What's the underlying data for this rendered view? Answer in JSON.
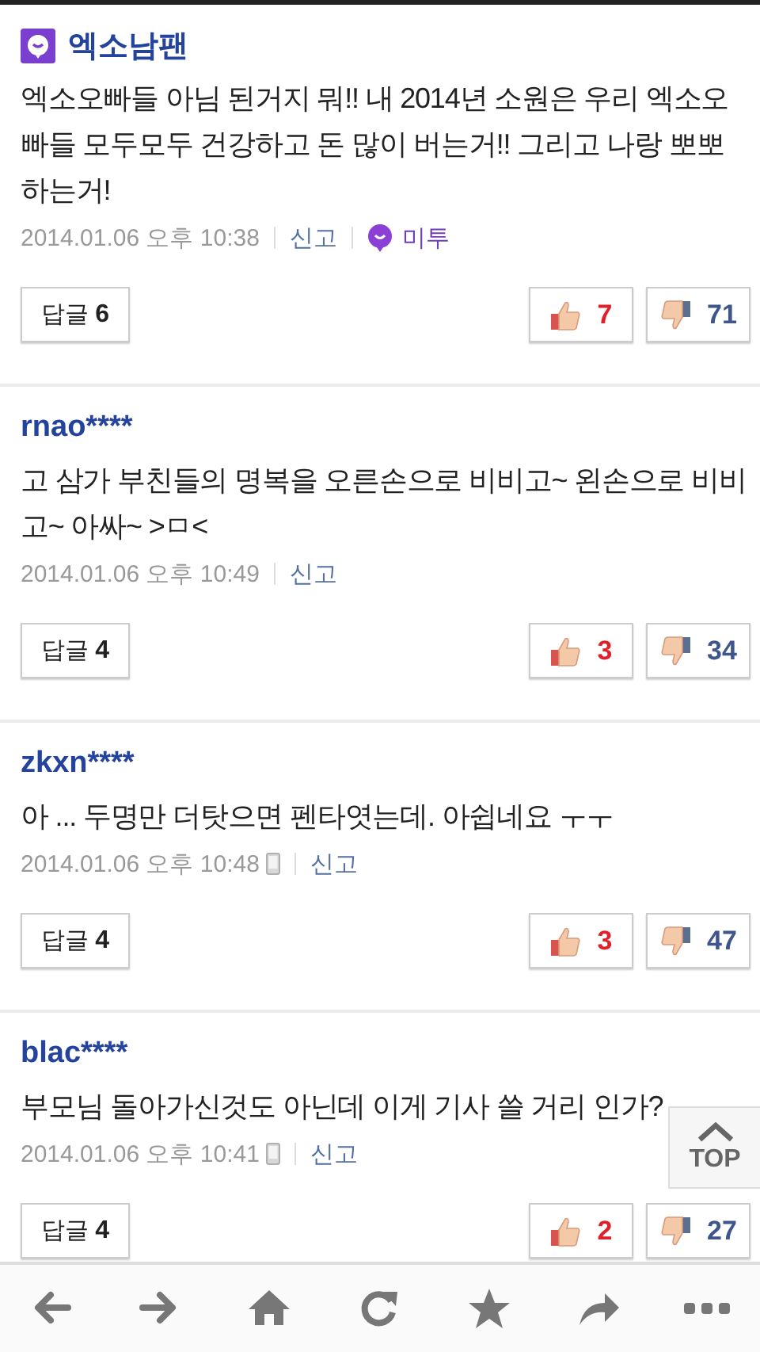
{
  "comments": [
    {
      "author": "엑소남팬",
      "author_badge": true,
      "text": "엑소오빠들 아님 된거지 뭐!! 내 2014년 소원은 우리 엑소오빠들 모두모두 건강하고 돈 많이 버는거!! 그리고 나랑 뽀뽀하는거!",
      "time": "2014.01.06 오후 10:38",
      "mobile": false,
      "report": "신고",
      "metoo": "미투",
      "reply_label": "답글",
      "reply_count": "6",
      "likes": "7",
      "dislikes": "71"
    },
    {
      "author": "rnao****",
      "author_badge": false,
      "text": "고 삼가 부친들의 명복을 오른손으로 비비고~ 왼손으로 비비고~ 아싸~ >ㅁ<",
      "time": "2014.01.06 오후 10:49",
      "mobile": false,
      "report": "신고",
      "reply_label": "답글",
      "reply_count": "4",
      "likes": "3",
      "dislikes": "34"
    },
    {
      "author": "zkxn****",
      "author_badge": false,
      "text": "아 ... 두명만 더탓으면 펜타엿는데. 아쉽네요 ㅜㅜ",
      "time": "2014.01.06 오후 10:48",
      "mobile": true,
      "report": "신고",
      "reply_label": "답글",
      "reply_count": "4",
      "likes": "3",
      "dislikes": "47"
    },
    {
      "author": "blac****",
      "author_badge": false,
      "text": "부모님 돌아가신것도 아닌데 이게 기사 쓸 거리 인가?",
      "time": "2014.01.06 오후 10:41",
      "mobile": true,
      "report": "신고",
      "reply_label": "답글",
      "reply_count": "4",
      "likes": "2",
      "dislikes": "27"
    }
  ],
  "top_button": "TOP",
  "toolbar": [
    {
      "kind": "back"
    },
    {
      "kind": "forward"
    },
    {
      "kind": "home"
    },
    {
      "kind": "refresh"
    },
    {
      "kind": "star"
    },
    {
      "kind": "share"
    },
    {
      "kind": "more"
    }
  ]
}
